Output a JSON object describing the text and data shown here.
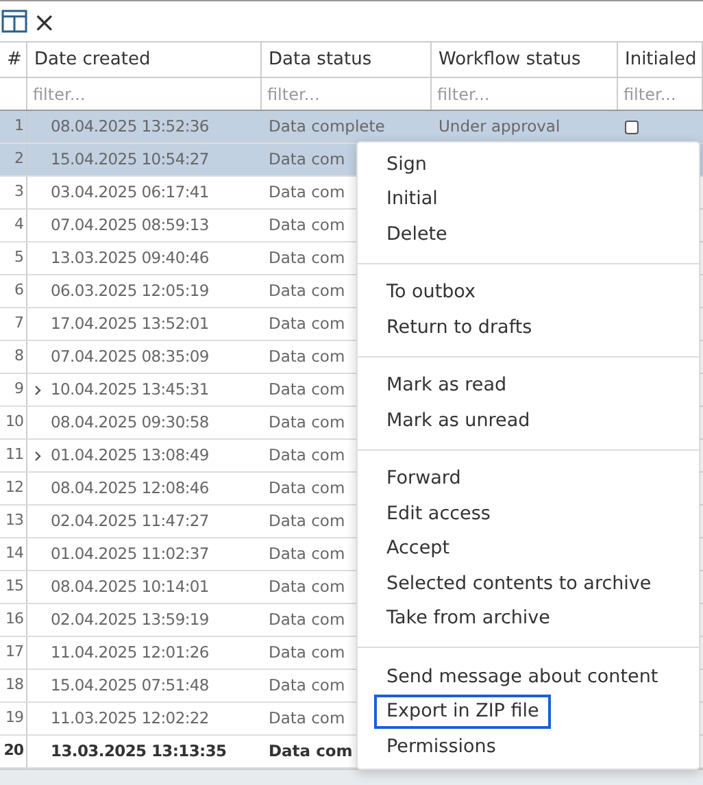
{
  "toolbar": {
    "close_label": "×"
  },
  "table": {
    "columns": [
      "#",
      "Date created",
      "Data status",
      "Workflow status",
      "Initialed"
    ],
    "filters": [
      {
        "placeholder": "filter..."
      },
      {
        "placeholder": "filter..."
      },
      {
        "placeholder": "filter..."
      },
      {
        "placeholder": "filter..."
      }
    ],
    "rows": [
      {
        "num": "1",
        "date": "08.04.2025 13:52:36",
        "data_status": "Data complete",
        "workflow": "Under approval",
        "initialed": false,
        "selected": true,
        "expandable": false,
        "bold": false
      },
      {
        "num": "2",
        "date": "15.04.2025 10:54:27",
        "data_status": "Data com",
        "selected": true,
        "expandable": false,
        "bold": false
      },
      {
        "num": "3",
        "date": "03.04.2025 06:17:41",
        "data_status": "Data com",
        "selected": false,
        "expandable": false,
        "bold": false
      },
      {
        "num": "4",
        "date": "07.04.2025 08:59:13",
        "data_status": "Data com",
        "selected": false,
        "expandable": false,
        "bold": false
      },
      {
        "num": "5",
        "date": "13.03.2025 09:40:46",
        "data_status": "Data com",
        "selected": false,
        "expandable": false,
        "bold": false
      },
      {
        "num": "6",
        "date": "06.03.2025 12:05:19",
        "data_status": "Data com",
        "selected": false,
        "expandable": false,
        "bold": false
      },
      {
        "num": "7",
        "date": "17.04.2025 13:52:01",
        "data_status": "Data com",
        "selected": false,
        "expandable": false,
        "bold": false
      },
      {
        "num": "8",
        "date": "07.04.2025 08:35:09",
        "data_status": "Data com",
        "selected": false,
        "expandable": false,
        "bold": false
      },
      {
        "num": "9",
        "date": "10.04.2025 13:45:31",
        "data_status": "Data com",
        "selected": false,
        "expandable": true,
        "bold": false
      },
      {
        "num": "10",
        "date": "08.04.2025 09:30:58",
        "data_status": "Data com",
        "selected": false,
        "expandable": false,
        "bold": false
      },
      {
        "num": "11",
        "date": "01.04.2025 13:08:49",
        "data_status": "Data com",
        "selected": false,
        "expandable": true,
        "bold": false
      },
      {
        "num": "12",
        "date": "08.04.2025 12:08:46",
        "data_status": "Data com",
        "selected": false,
        "expandable": false,
        "bold": false
      },
      {
        "num": "13",
        "date": "02.04.2025 11:47:27",
        "data_status": "Data com",
        "selected": false,
        "expandable": false,
        "bold": false
      },
      {
        "num": "14",
        "date": "01.04.2025 11:02:37",
        "data_status": "Data com",
        "selected": false,
        "expandable": false,
        "bold": false
      },
      {
        "num": "15",
        "date": "08.04.2025 10:14:01",
        "data_status": "Data com",
        "selected": false,
        "expandable": false,
        "bold": false
      },
      {
        "num": "16",
        "date": "02.04.2025 13:59:19",
        "data_status": "Data com",
        "selected": false,
        "expandable": false,
        "bold": false
      },
      {
        "num": "17",
        "date": "11.04.2025 12:01:26",
        "data_status": "Data com",
        "selected": false,
        "expandable": false,
        "bold": false
      },
      {
        "num": "18",
        "date": "15.04.2025 07:51:48",
        "data_status": "Data com",
        "selected": false,
        "expandable": false,
        "bold": false
      },
      {
        "num": "19",
        "date": "11.03.2025 12:02:22",
        "data_status": "Data com",
        "selected": false,
        "expandable": false,
        "bold": false
      },
      {
        "num": "20",
        "date": "13.03.2025 13:13:35",
        "data_status": "Data com",
        "selected": false,
        "expandable": false,
        "bold": true
      }
    ]
  },
  "context_menu": {
    "sections": [
      [
        {
          "label": "Sign",
          "focused": false
        },
        {
          "label": "Initial",
          "focused": false
        },
        {
          "label": "Delete",
          "focused": false
        }
      ],
      [
        {
          "label": "To outbox",
          "focused": false
        },
        {
          "label": "Return to drafts",
          "focused": false
        }
      ],
      [
        {
          "label": "Mark as read",
          "focused": false
        },
        {
          "label": "Mark as unread",
          "focused": false
        }
      ],
      [
        {
          "label": "Forward",
          "focused": false
        },
        {
          "label": "Edit access",
          "focused": false
        },
        {
          "label": "Accept",
          "focused": false
        },
        {
          "label": "Selected contents to archive",
          "focused": false
        },
        {
          "label": "Take from archive",
          "focused": false
        }
      ],
      [
        {
          "label": "Send message about content",
          "focused": false
        },
        {
          "label": "Export in ZIP file",
          "focused": true
        },
        {
          "label": "Permissions",
          "focused": false
        }
      ]
    ]
  }
}
